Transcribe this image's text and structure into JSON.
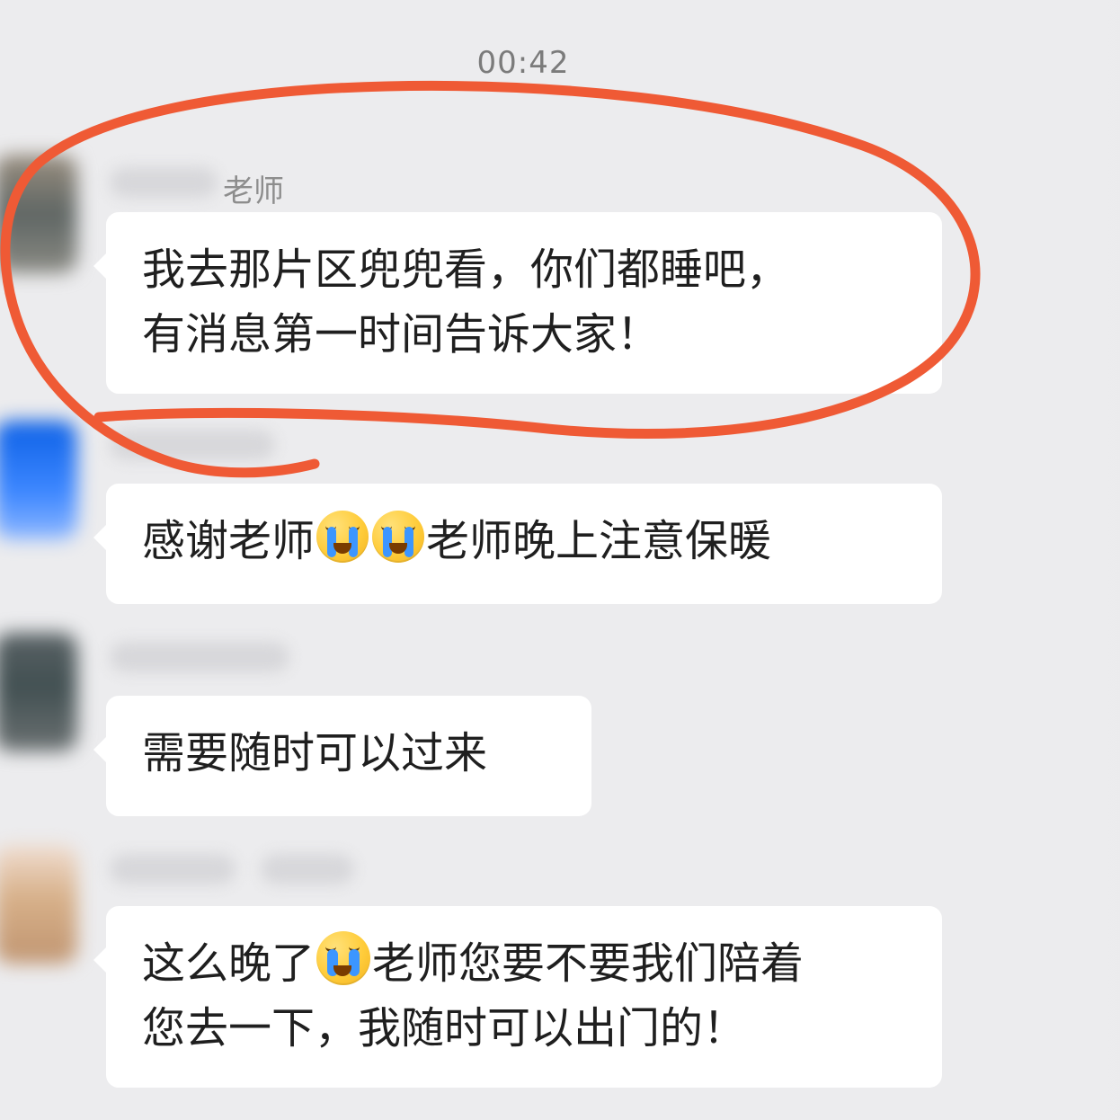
{
  "chat": {
    "timestamp": "00:42",
    "colors": {
      "background": "#ececee",
      "bubble": "#ffffff",
      "annotation": "#ef5a35",
      "text": "#1f1f1f",
      "muted_text": "#8d8d8d"
    },
    "messages": [
      {
        "sender_name": "老师",
        "lines": [
          "我去那片区兜兜看，你们都睡吧，",
          "有消息第一时间告诉大家！"
        ]
      },
      {
        "sender_name": "",
        "line_segments": [
          "感谢老师",
          "老师晚上注意保暖"
        ],
        "emoji_icons": [
          "crying-face-icon",
          "crying-face-icon"
        ]
      },
      {
        "sender_name": "",
        "lines": [
          "需要随时可以过来"
        ]
      },
      {
        "sender_name": "",
        "line_segments": [
          "这么晚了",
          "老师您要不要我们陪着",
          "您去一下，我随时可以出门的！"
        ],
        "emoji_icons": [
          "pleading-face-icon"
        ]
      }
    ],
    "annotation": {
      "type": "hand-drawn-circle"
    }
  }
}
